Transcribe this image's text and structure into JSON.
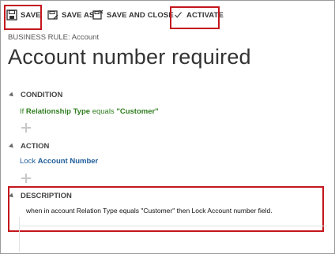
{
  "toolbar": {
    "save_label": "SAVE",
    "save_as_label": "SAVE AS",
    "save_and_close_label": "SAVE AND CLOSE",
    "activate_label": "ACTIVATE"
  },
  "breadcrumb": "BUSINESS RULE: Account",
  "title": "Account number required",
  "condition": {
    "header": "CONDITION",
    "prefix": "If",
    "field": "Relationship Type",
    "operator": "equals",
    "value": "\"Customer\""
  },
  "action": {
    "header": "ACTION",
    "verb": "Lock",
    "field": "Account Number"
  },
  "description": {
    "header": "DESCRIPTION",
    "text": "when in account Relation Type equals \"Customer\" then Lock Account number field."
  },
  "colors": {
    "highlight": "#c4161c",
    "condition_green": "#2f7d1f",
    "action_blue": "#1f5c99"
  }
}
